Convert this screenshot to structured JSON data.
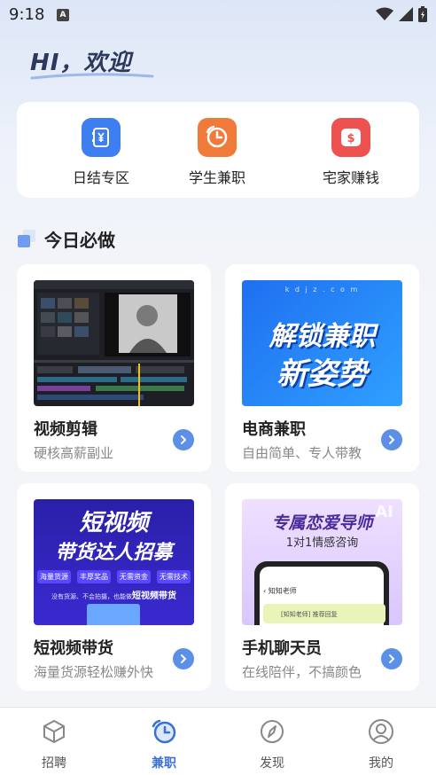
{
  "status": {
    "time": "9:18",
    "notif_letter": "A"
  },
  "greeting": "HI，欢迎",
  "quick_links": [
    {
      "label": "日结专区",
      "icon": "yen-wallet-icon",
      "color": "#3d7ff0"
    },
    {
      "label": "学生兼职",
      "icon": "clock-icon",
      "color": "#f07a3a"
    },
    {
      "label": "宅家赚钱",
      "icon": "dollar-coin-icon",
      "color": "#ee5250"
    }
  ],
  "section_title": "今日必做",
  "cards": [
    {
      "title": "视频剪辑",
      "subtitle": "硬核高薪副业"
    },
    {
      "title": "电商兼职",
      "subtitle": "自由简单、专人带教",
      "banner_small": "k d j z . c o m",
      "banner_line1": "解锁兼职",
      "banner_line2": "新姿势"
    },
    {
      "title": "短视频带货",
      "subtitle": "海量货源轻松赚外快",
      "banner_line1": "短视频",
      "banner_line2": "带货达人招募",
      "tags": [
        "海量货源",
        "丰厚奖品",
        "无需资金",
        "无需技术"
      ],
      "banner_foot_plain": "没有货源、不会拍摄，也能做",
      "banner_foot_strong": "短视频带货"
    },
    {
      "title": "手机聊天员",
      "subtitle": "在线陪伴，不搞颜色",
      "banner_line1": "专属恋爱导师",
      "banner_line2": "1对1情感咨询",
      "phone_header": "知知老师",
      "chat_text": "[知知老师] 推荐回复",
      "ai_mark": "AI"
    }
  ],
  "tabs": [
    {
      "label": "招聘",
      "icon": "cube-icon",
      "active": false
    },
    {
      "label": "兼职",
      "icon": "clock-icon",
      "active": true
    },
    {
      "label": "发现",
      "icon": "compass-icon",
      "active": false
    },
    {
      "label": "我的",
      "icon": "user-icon",
      "active": false
    }
  ]
}
